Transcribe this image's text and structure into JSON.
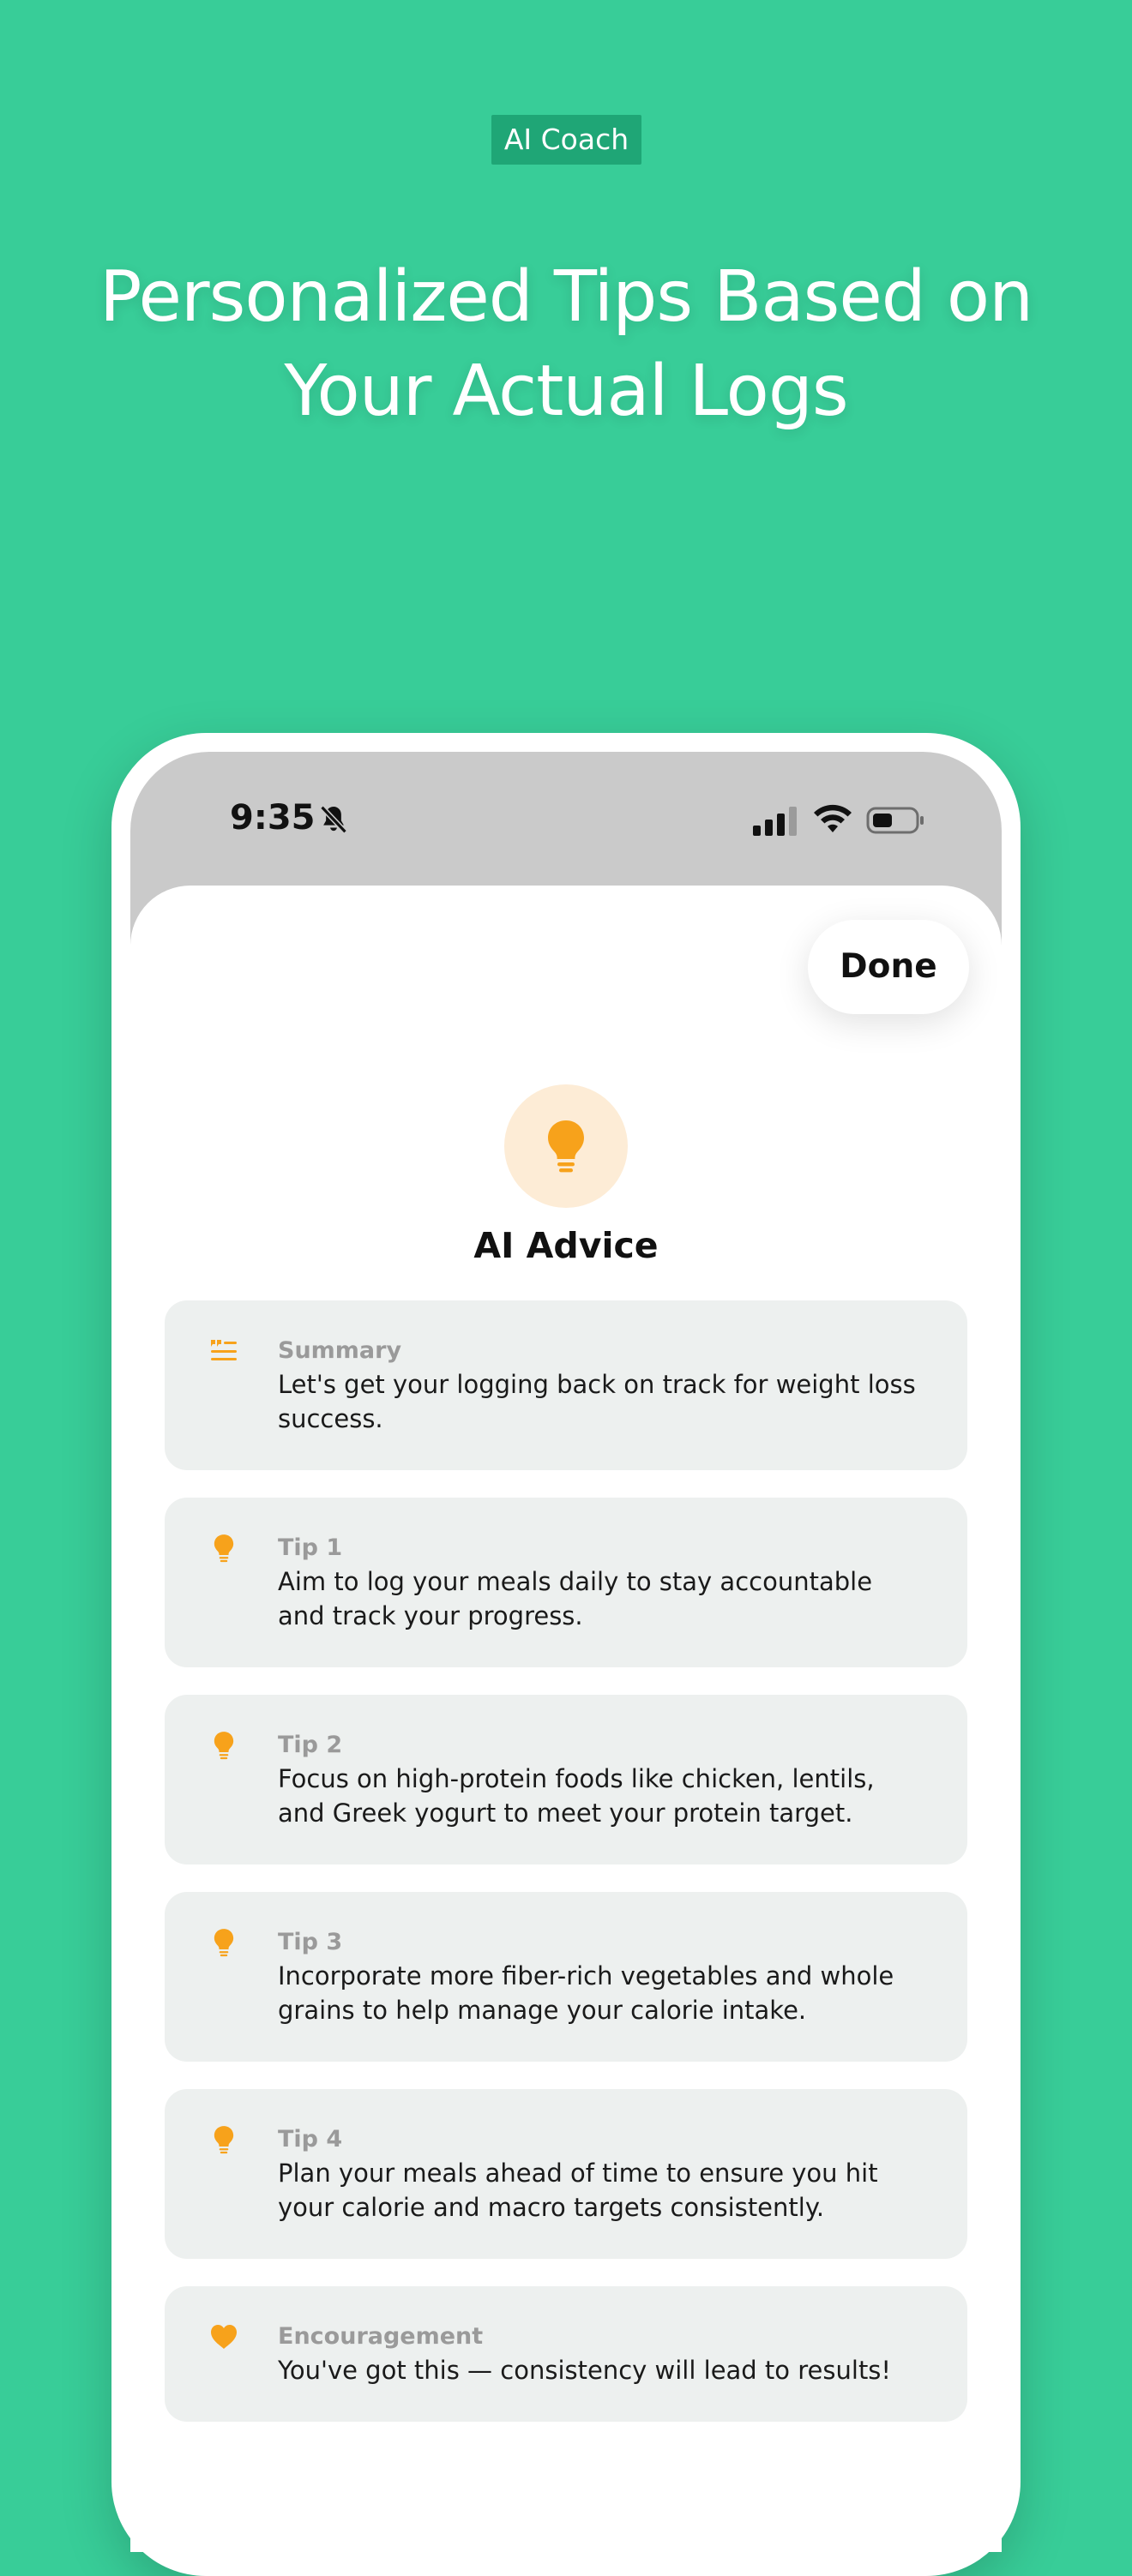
{
  "promo": {
    "badge": "AI Coach",
    "headline": "Personalized Tips Based on Your Actual Logs"
  },
  "status_bar": {
    "time": "9:35",
    "icons": [
      "bell-slash-icon",
      "cellular-signal-icon",
      "wifi-icon",
      "battery-icon"
    ]
  },
  "sheet": {
    "done_label": "Done",
    "hero_icon": "lightbulb-icon",
    "title": "AI Advice",
    "accent_color": "#f7a21b",
    "cards": [
      {
        "icon": "text-summary-icon",
        "label": "Summary",
        "text": "Let's get your logging back on track for weight loss success."
      },
      {
        "icon": "lightbulb-icon",
        "label": "Tip 1",
        "text": "Aim to log your meals daily to stay accountable and track your progress."
      },
      {
        "icon": "lightbulb-icon",
        "label": "Tip 2",
        "text": "Focus on high-protein foods like chicken, lentils, and Greek yogurt to meet your protein target."
      },
      {
        "icon": "lightbulb-icon",
        "label": "Tip 3",
        "text": "Incorporate more fiber-rich vegetables and whole grains to help manage your calorie intake."
      },
      {
        "icon": "lightbulb-icon",
        "label": "Tip 4",
        "text": "Plan your meals ahead of time to ensure you hit your calorie and macro targets consistently."
      },
      {
        "icon": "heart-icon",
        "label": "Encouragement",
        "text": "You've got this — consistency will lead to results!"
      }
    ]
  }
}
